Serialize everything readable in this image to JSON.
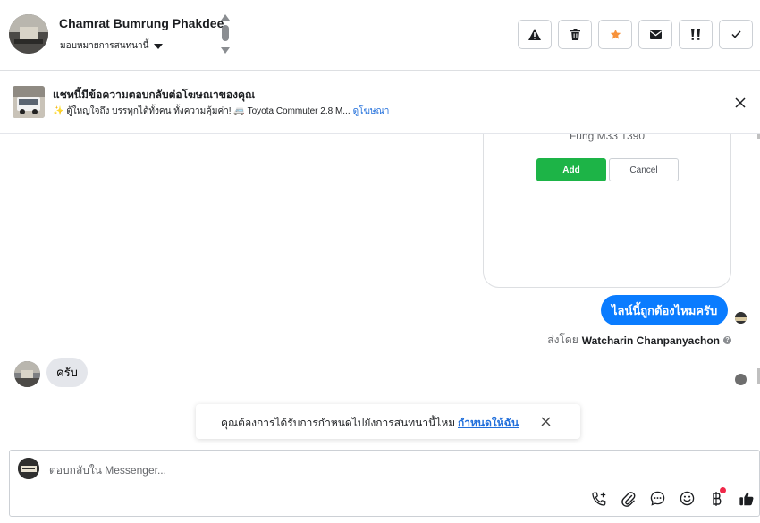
{
  "header": {
    "contact_name": "Chamrat Bumrung Phakdee",
    "assign_label": "มอบหมายการสนทนานี้",
    "toolbar": [
      {
        "name": "warning-button",
        "icon": "warning-icon"
      },
      {
        "name": "delete-button",
        "icon": "trash-icon"
      },
      {
        "name": "star-button",
        "icon": "star-icon",
        "color": "#f7923b"
      },
      {
        "name": "mail-button",
        "icon": "envelope-icon"
      },
      {
        "name": "priority-button",
        "icon": "priority-icon"
      },
      {
        "name": "done-button",
        "icon": "check-icon"
      }
    ]
  },
  "ad_banner": {
    "title": "แชทนี้มีข้อความตอบกลับต่อโฆษณาของคุณ",
    "description": "✨ ตู้ใหญ่ใจถึง บรรทุกได้ทั้งคน ทั้งความคุ้มค่า! 🚐 Toyota Commuter 2.8 M...",
    "link": "ดูโฆษณา"
  },
  "chat": {
    "card": {
      "title": "Fung M33 1390",
      "add_label": "Add",
      "cancel_label": "Cancel",
      "add_color": "#1db447"
    },
    "outgoing_message": "ไลน์นี้ถูกต้องไหมครับ",
    "outgoing_color": "#0a7cff",
    "sent_by_prefix": "ส่งโดย",
    "sent_by_name": "Watcharin Chanpanyachon",
    "incoming_message": "ครับ",
    "notice": {
      "text": "คุณต้องการได้รับการกำหนดไปยังการสนทนานี้ไหม",
      "link": "กำหนดให้ฉัน"
    }
  },
  "composer": {
    "placeholder": "ตอบกลับใน Messenger...",
    "icons": [
      "phone-plus-icon",
      "paperclip-icon",
      "chat-bubble-icon",
      "smiley-icon",
      "baht-icon",
      "thumbs-up-icon"
    ]
  }
}
